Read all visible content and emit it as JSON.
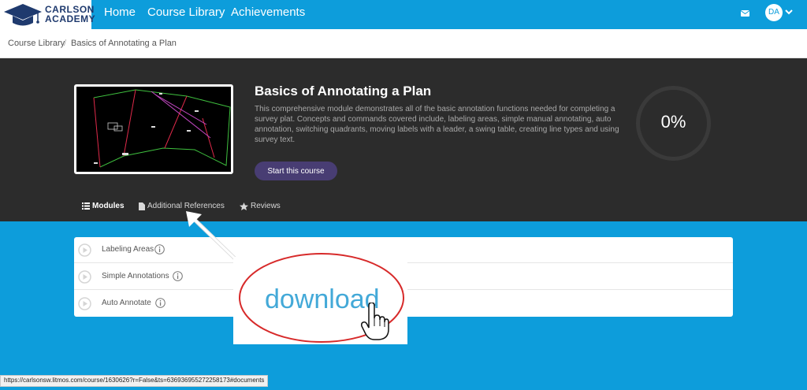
{
  "brand": {
    "line1": "CARLSON",
    "line2": "ACADEMY"
  },
  "nav": {
    "links": [
      "Home",
      "Course Library",
      "Achievements"
    ],
    "avatar_initials": "DA",
    "icons": [
      "mail-icon",
      "chevron-down-icon"
    ]
  },
  "breadcrumb": [
    "Course Library",
    "Basics of Annotating a Plan"
  ],
  "course": {
    "title": "Basics of Annotating a Plan",
    "description": "This comprehensive module demonstrates all of the basic annotation functions needed for completing a survey plat. Concepts and commands covered include, labeling areas, simple manual annotating, auto annotation, switching quadrants, moving labels with a leader, a swing table, creating line types and using survey text.",
    "start_label": "Start this course",
    "progress_percent": 0,
    "progress_label": "0%"
  },
  "tabs": [
    "Modules",
    "Additional References",
    "Reviews"
  ],
  "modules": [
    "Labeling Areas",
    "Simple Annotations",
    "Auto Annotate"
  ],
  "callout": {
    "text": "download"
  },
  "status_url": "https://carlsonsw.litmos.com/course/1630626?r=False&ts=636936955272258173#documents",
  "colors": {
    "brand_blue": "#0d9ddb",
    "hero_dark": "#2c2c2c",
    "button_purple": "#483d73",
    "callout_red": "#d72a2a"
  }
}
